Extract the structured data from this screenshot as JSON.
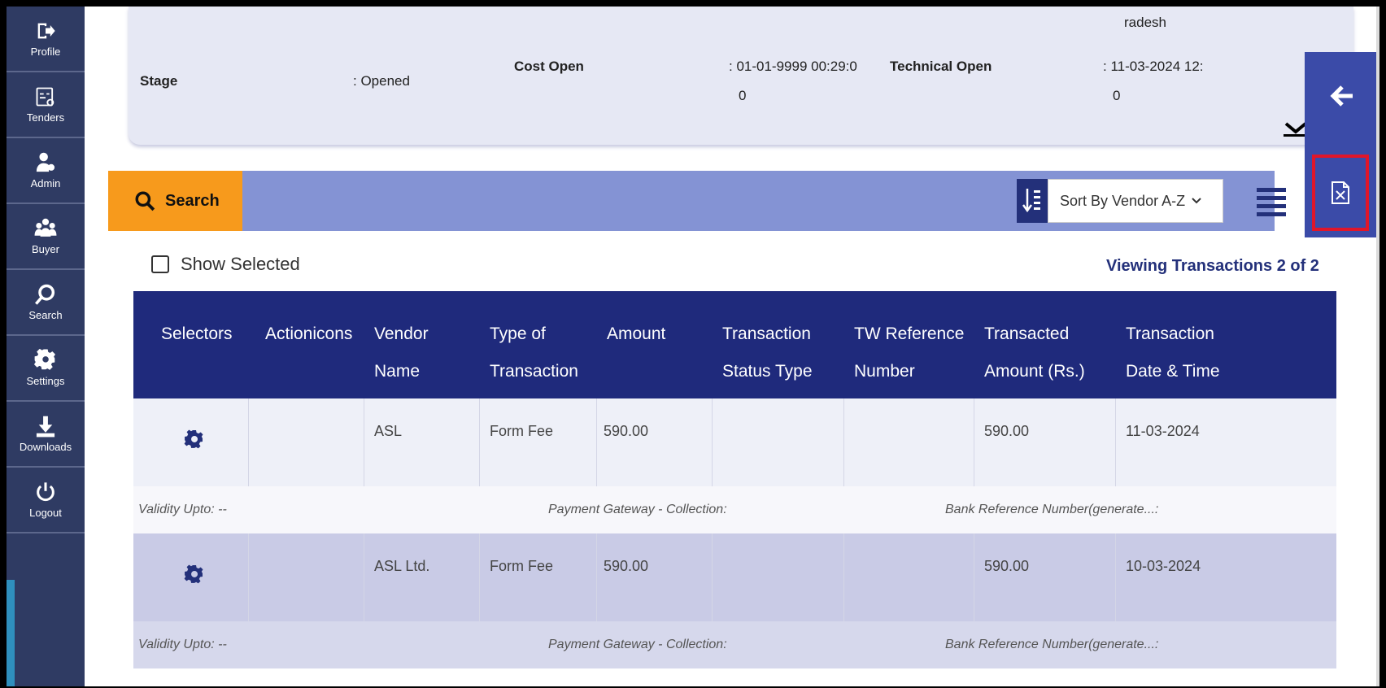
{
  "sidebar": {
    "items": [
      {
        "label": "Profile",
        "icon": "profile-icon"
      },
      {
        "label": "Tenders",
        "icon": "tenders-icon"
      },
      {
        "label": "Admin",
        "icon": "admin-icon"
      },
      {
        "label": "Buyer",
        "icon": "buyer-icon"
      },
      {
        "label": "Search",
        "icon": "search-icon"
      },
      {
        "label": "Settings",
        "icon": "settings-icon"
      },
      {
        "label": "Downloads",
        "icon": "download-icon"
      },
      {
        "label": "Logout",
        "icon": "logout-icon"
      }
    ]
  },
  "info": {
    "top_name": "radesh",
    "stage_label": "Stage",
    "stage_value": ": Opened",
    "cost_open_label": "Cost Open",
    "cost_open_value_line1": ": 01-01-9999 00:29:0",
    "cost_open_value_line2": "0",
    "technical_open_label": "Technical Open",
    "technical_open_value_line1": ": 11-03-2024 12:",
    "technical_open_value_line2": "0"
  },
  "toolbar": {
    "search_label": "Search",
    "sort_value": "Sort By Vendor A-Z"
  },
  "content": {
    "show_selected": "Show Selected",
    "viewing": "Viewing Transactions 2 of 2"
  },
  "table": {
    "headers": [
      {
        "l1": "Selectors",
        "l2": ""
      },
      {
        "l1": "Actionicons",
        "l2": ""
      },
      {
        "l1": "Vendor",
        "l2": "Name"
      },
      {
        "l1": "Type of",
        "l2": "Transaction"
      },
      {
        "l1": "Amount",
        "l2": ""
      },
      {
        "l1": "Transaction",
        "l2": "Status Type"
      },
      {
        "l1": "TW Reference",
        "l2": "Number"
      },
      {
        "l1": "Transacted",
        "l2": "Amount (Rs.)"
      },
      {
        "l1": "Transaction",
        "l2": "Date & Time"
      }
    ],
    "rows": [
      {
        "vendor": "ASL",
        "type": "Form Fee",
        "amount": "590.00",
        "status": "",
        "tw_ref": "",
        "transacted": "590.00",
        "date": "11-03-2024",
        "validity": "Validity Upto: --",
        "gateway": "Payment Gateway - Collection:",
        "bank_ref": "Bank Reference Number(generate...:"
      },
      {
        "vendor": "ASL Ltd.",
        "type": "Form Fee",
        "amount": "590.00",
        "status": "",
        "tw_ref": "",
        "transacted": "590.00",
        "date": "10-03-2024",
        "validity": "Validity Upto: --",
        "gateway": "Payment Gateway - Collection:",
        "bank_ref": "Bank Reference Number(generate...:"
      }
    ]
  },
  "colors": {
    "sidebar": "#2f3b63",
    "header": "#1f2a7c",
    "toolbar": "#8493d4",
    "search_button": "#f79a1c",
    "highlight": "#e0162a"
  }
}
